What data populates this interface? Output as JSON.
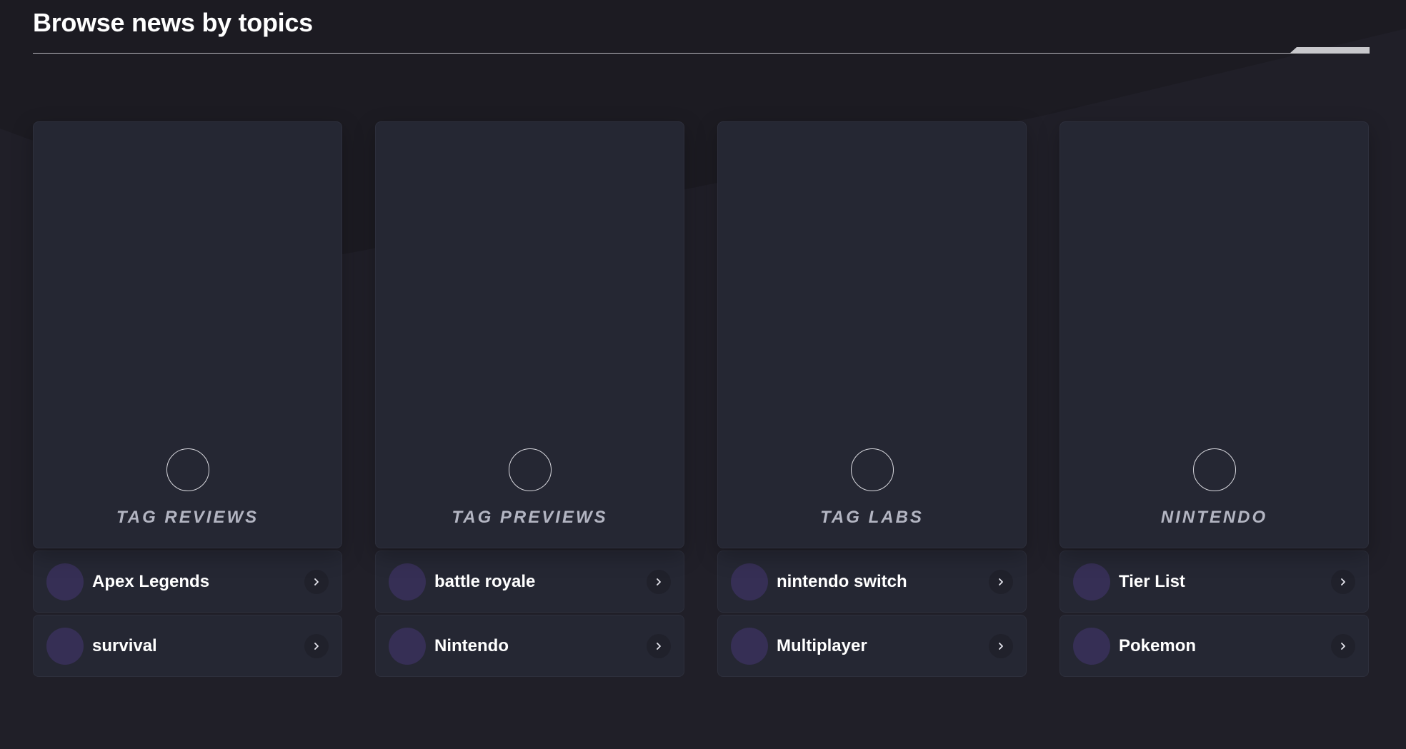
{
  "header": {
    "title": "Browse news by topics"
  },
  "topics": [
    {
      "label": "TAG REVIEWS",
      "tags": [
        {
          "name": "Apex Legends",
          "icon": "chevron-right-icon"
        },
        {
          "name": "survival",
          "icon": "chevron-right-icon"
        }
      ]
    },
    {
      "label": "TAG PREVIEWS",
      "tags": [
        {
          "name": "battle royale",
          "icon": "chevron-right-icon"
        },
        {
          "name": "Nintendo",
          "icon": "chevron-right-icon"
        }
      ]
    },
    {
      "label": "TAG LABS",
      "tags": [
        {
          "name": "nintendo switch",
          "icon": "chevron-right-icon"
        },
        {
          "name": "Multiplayer",
          "icon": "chevron-right-icon"
        }
      ]
    },
    {
      "label": "NINTENDO",
      "tags": [
        {
          "name": "Tier List",
          "icon": "chevron-right-icon"
        },
        {
          "name": "Pokemon",
          "icon": "chevron-right-icon"
        }
      ]
    }
  ],
  "colors": {
    "background": "#1c1b22",
    "card": "#252733",
    "avatar": "#362f55",
    "label": "#b3b5c2"
  }
}
